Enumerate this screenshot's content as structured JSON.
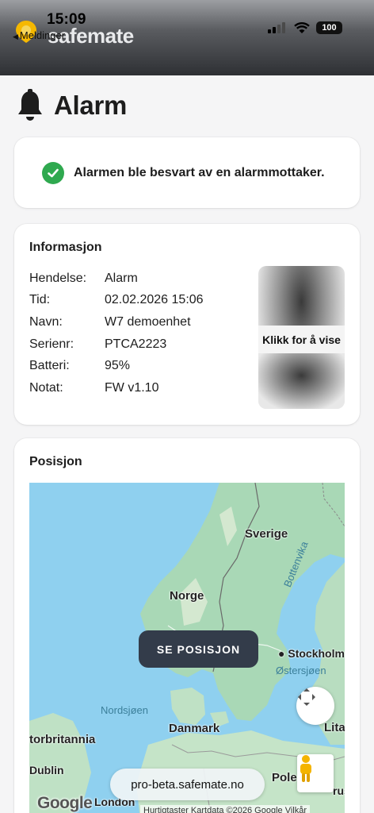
{
  "status_bar": {
    "time": "15:09",
    "back_label": "Meldinger",
    "battery": "100"
  },
  "header": {
    "brand": "safemate"
  },
  "page": {
    "title": "Alarm"
  },
  "status_card": {
    "message": "Alarmen ble besvart av en alarmmottaker."
  },
  "info": {
    "title": "Informasjon",
    "rows": [
      {
        "label": "Hendelse:",
        "value": "Alarm"
      },
      {
        "label": "Tid:",
        "value": "02.02.2026 15:06"
      },
      {
        "label": "Navn:",
        "value": "W7 demoenhet"
      },
      {
        "label": "Serienr:",
        "value": "PTCA2223"
      },
      {
        "label": "Batteri:",
        "value": "95%"
      },
      {
        "label": "Notat:",
        "value": "FW v1.10"
      }
    ],
    "image_label": "Klikk for å vise"
  },
  "position": {
    "title": "Posisjon",
    "button": "SE POSISJON",
    "labels": {
      "sverige": "Sverige",
      "norge": "Norge",
      "bottenvika": "Bottenvika",
      "stockholm": "Stockholm",
      "ostersjoen": "Østersjøen",
      "nordsjoen": "Nordsjøen",
      "danmark": "Danmark",
      "storbritannia": "torbritannia",
      "dublin": "Dublin",
      "london": "London",
      "polen": "Pole",
      "litauen": "Lita",
      "hviterussland": "rus"
    },
    "google": "Google",
    "footer": "Hurtigtaster   Kartdata ©2026 Google   Vilkår"
  },
  "browser": {
    "url": "pro-beta.safemate.no"
  },
  "colors": {
    "accent_green": "#2fa94f",
    "button_dark": "#333c4a",
    "logo_yellow": "#f5b800"
  }
}
